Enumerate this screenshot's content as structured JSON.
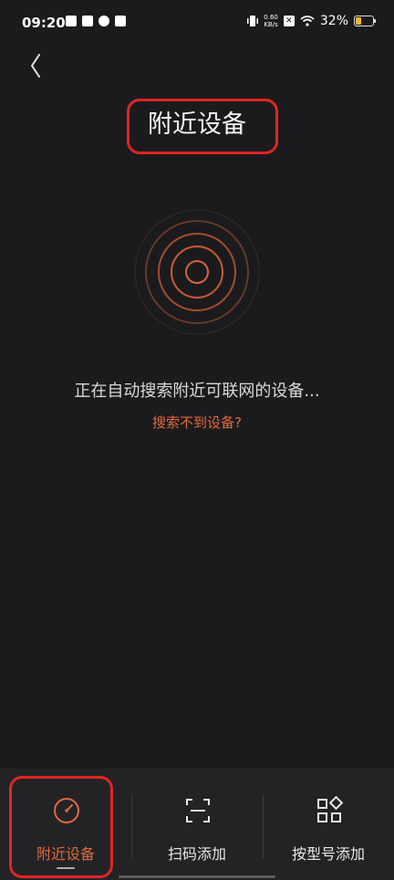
{
  "status_bar": {
    "time": "09:20",
    "net_speed_value": "0.60",
    "net_speed_unit": "KB/s",
    "battery_percent": "32%"
  },
  "header": {
    "title": "附近设备"
  },
  "main": {
    "searching_text": "正在自动搜索附近可联网的设备...",
    "help_link": "搜索不到设备?"
  },
  "bottom_nav": {
    "tabs": [
      {
        "label": "附近设备",
        "icon": "gauge-icon",
        "active": true
      },
      {
        "label": "扫码添加",
        "icon": "scan-icon",
        "active": false
      },
      {
        "label": "按型号添加",
        "icon": "grid-icon",
        "active": false
      }
    ]
  },
  "colors": {
    "accent": "#e06a3d",
    "background": "#1b1b1e",
    "highlight": "#e22424"
  }
}
